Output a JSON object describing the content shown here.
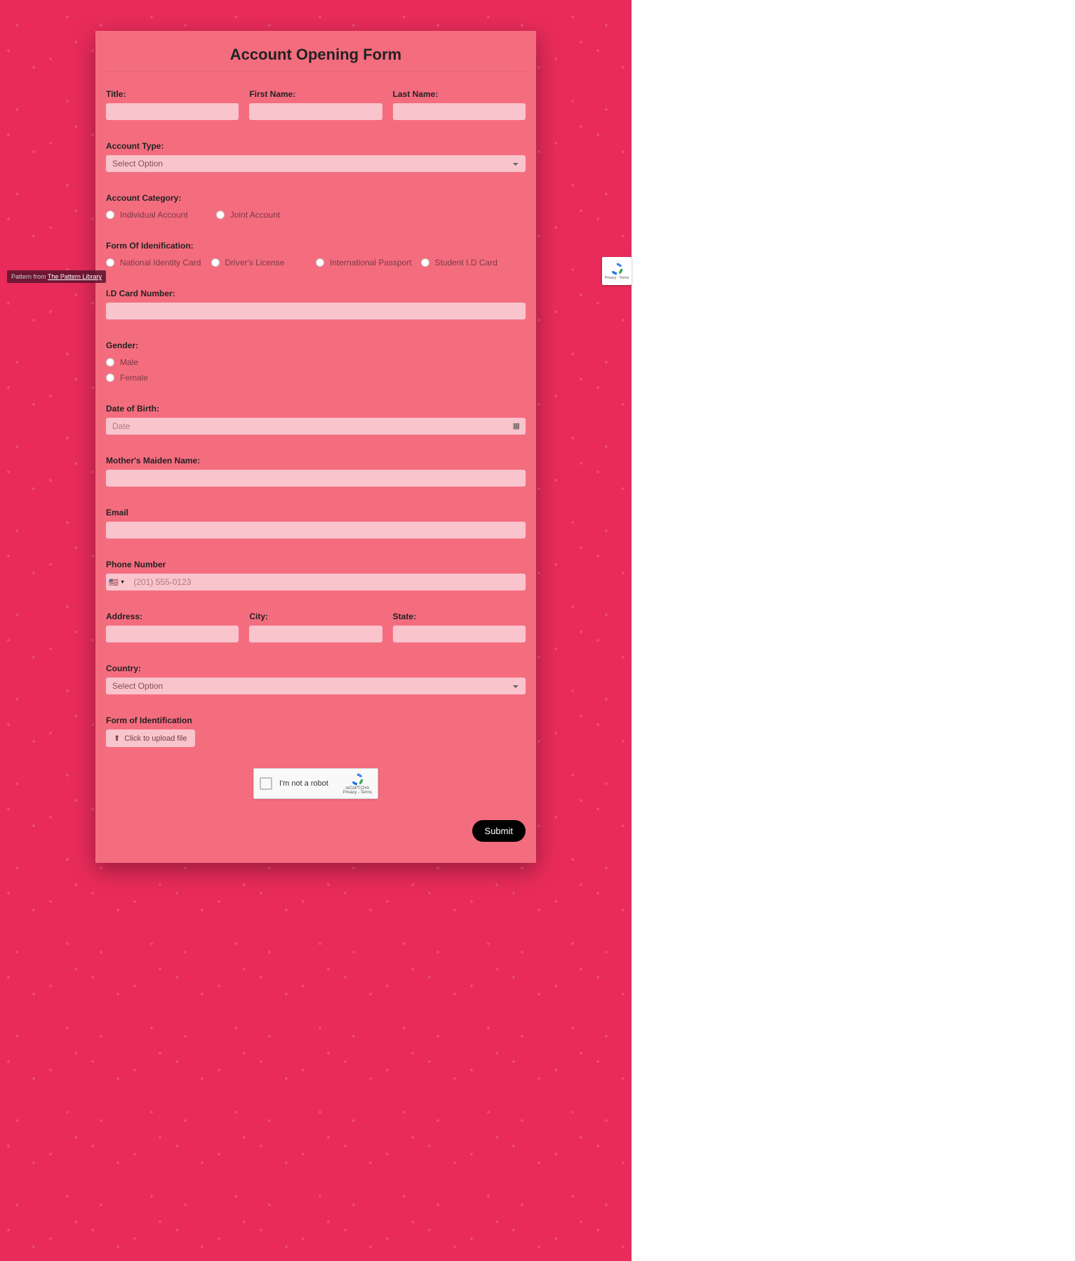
{
  "form": {
    "title": "Account Opening Form",
    "labels": {
      "title": "Title:",
      "first_name": "First Name:",
      "last_name": "Last Name:",
      "account_type": "Account Type:",
      "account_category": "Account Category:",
      "form_of_id": "Form Of Idenification:",
      "id_card_number": "I.D Card Number:",
      "gender": "Gender:",
      "dob": "Date of Birth:",
      "mother_maiden": "Mother's Maiden Name:",
      "email": "Email",
      "phone": "Phone Number",
      "address": "Address:",
      "city": "City:",
      "state": "State:",
      "country": "Country:",
      "form_of_identification": "Form of Identification"
    },
    "placeholders": {
      "select_option": "Select Option",
      "date": "Date",
      "phone": "(201) 555-0123"
    },
    "options": {
      "account_category": [
        "Individual Account",
        "Joint Account"
      ],
      "form_of_id": [
        "National Identity Card",
        "Driver's License",
        "International Passport",
        "Student I.D Card"
      ],
      "gender": [
        "Male",
        "Female"
      ]
    },
    "upload": {
      "label": "Click to upload file"
    },
    "captcha": {
      "text": "I'm not a robot",
      "brand": "reCAPTCHA",
      "sub": "Privacy - Terms"
    },
    "submit": "Submit"
  },
  "badge": {
    "prefix": "Pattern from ",
    "link_text": "The Pattern Library"
  },
  "recaptcha_side": {
    "sub": "Privacy - Terms"
  }
}
